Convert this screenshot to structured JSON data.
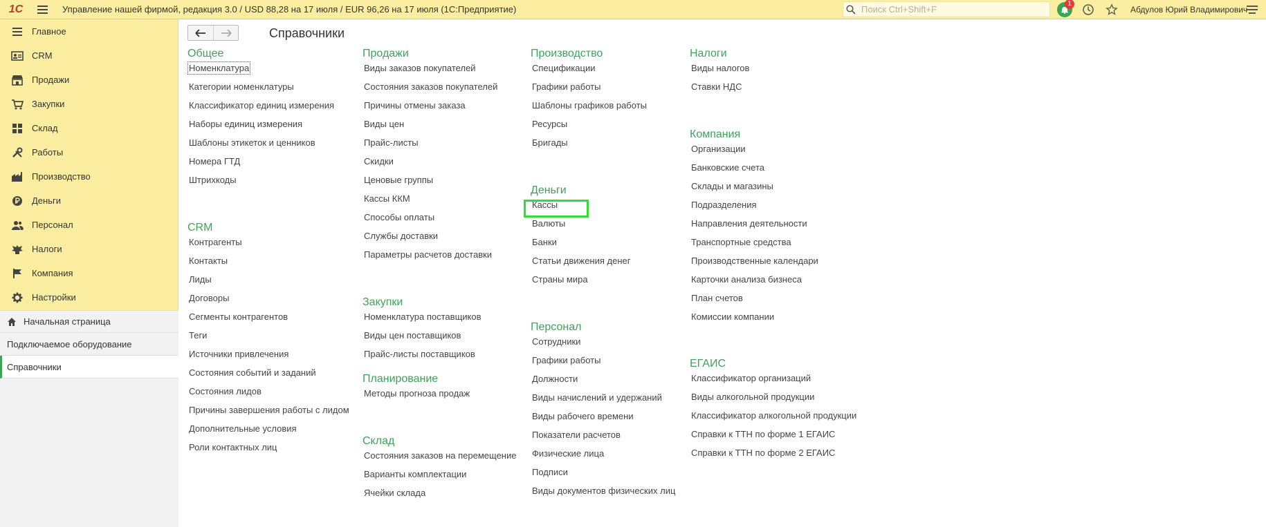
{
  "topbar": {
    "logo": "1С",
    "title": "Управление нашей фирмой, редакция 3.0 / USD 88,28 на 17 июля / EUR 96,26 на 17 июля  (1С:Предприятие)",
    "search_placeholder": "Поиск Ctrl+Shift+F",
    "notification_count": "1",
    "user": "Абдулов Юрий Владимирович"
  },
  "sidebar": {
    "items": [
      {
        "label": "Главное",
        "icon": "list-icon"
      },
      {
        "label": "CRM",
        "icon": "contact-card-icon"
      },
      {
        "label": "Продажи",
        "icon": "shop-icon"
      },
      {
        "label": "Закупки",
        "icon": "cart-icon"
      },
      {
        "label": "Склад",
        "icon": "warehouse-icon"
      },
      {
        "label": "Работы",
        "icon": "tools-icon"
      },
      {
        "label": "Производство",
        "icon": "factory-icon"
      },
      {
        "label": "Деньги",
        "icon": "ruble-icon"
      },
      {
        "label": "Персонал",
        "icon": "people-icon"
      },
      {
        "label": "Налоги",
        "icon": "emblem-icon"
      },
      {
        "label": "Компания",
        "icon": "flag-icon"
      },
      {
        "label": "Настройки",
        "icon": "gear-icon"
      }
    ],
    "lower": {
      "home": "Начальная страница",
      "equipment": "Подключаемое оборудование",
      "references": "Справочники"
    }
  },
  "content": {
    "title": "Справочники",
    "sections": {
      "obshchee": {
        "title": "Общее",
        "links": [
          "Номенклатура",
          "Категории номенклатуры",
          "Классификатор единиц измерения",
          "Наборы единиц измерения",
          "Шаблоны этикеток и ценников",
          "Номера ГТД",
          "Штрихкоды"
        ]
      },
      "crm": {
        "title": "CRM",
        "links": [
          "Контрагенты",
          "Контакты",
          "Лиды",
          "Договоры",
          "Сегменты контрагентов",
          "Теги",
          "Источники привлечения",
          "Состояния событий и заданий",
          "Состояния лидов",
          "Причины завершения работы с лидом",
          "Дополнительные условия",
          "Роли контактных лиц"
        ]
      },
      "prodazhi": {
        "title": "Продажи",
        "links": [
          "Виды заказов покупателей",
          "Состояния заказов покупателей",
          "Причины отмены заказа",
          "Виды цен",
          "Прайс-листы",
          "Скидки",
          "Ценовые группы",
          "Кассы ККМ",
          "Способы оплаты",
          "Службы доставки",
          "Параметры расчетов доставки"
        ]
      },
      "zakupki": {
        "title": "Закупки",
        "links": [
          "Номенклатура поставщиков",
          "Виды цен поставщиков",
          "Прайс-листы поставщиков"
        ]
      },
      "planirovanie": {
        "title": "Планирование",
        "links": [
          "Методы прогноза продаж"
        ]
      },
      "sklad": {
        "title": "Склад",
        "links": [
          "Состояния заказов на перемещение",
          "Варианты комплектации",
          "Ячейки склада"
        ]
      },
      "proizvodstvo": {
        "title": "Производство",
        "links": [
          "Спецификации",
          "Графики работы",
          "Шаблоны графиков работы",
          "Ресурсы",
          "Бригады"
        ]
      },
      "dengi": {
        "title": "Деньги",
        "links": [
          "Кассы",
          "Валюты",
          "Банки",
          "Статьи движения денег",
          "Страны мира"
        ]
      },
      "personal": {
        "title": "Персонал",
        "links": [
          "Сотрудники",
          "Графики работы",
          "Должности",
          "Виды начислений и удержаний",
          "Виды рабочего времени",
          "Показатели расчетов",
          "Физические лица",
          "Подписи",
          "Виды документов физических лиц"
        ]
      },
      "nalogi": {
        "title": "Налоги",
        "links": [
          "Виды налогов",
          "Ставки НДС"
        ]
      },
      "kompaniya": {
        "title": "Компания",
        "links": [
          "Организации",
          "Банковские счета",
          "Склады и магазины",
          "Подразделения",
          "Направления деятельности",
          "Транспортные средства",
          "Производственные календари",
          "Карточки анализа бизнеса",
          "План счетов",
          "Комиссии компании"
        ]
      },
      "egais": {
        "title": "ЕГАИС",
        "links": [
          "Классификатор организаций",
          "Виды алкогольной продукции",
          "Классификатор алкогольной продукции",
          "Справки к ТТН по форме 1 ЕГАИС",
          "Справки к ТТН по форме 2 ЕГАИС"
        ]
      }
    }
  },
  "colors": {
    "topbar_bg": "#fbeea1",
    "section_title": "#3aa655",
    "highlight": "#29e32e"
  }
}
